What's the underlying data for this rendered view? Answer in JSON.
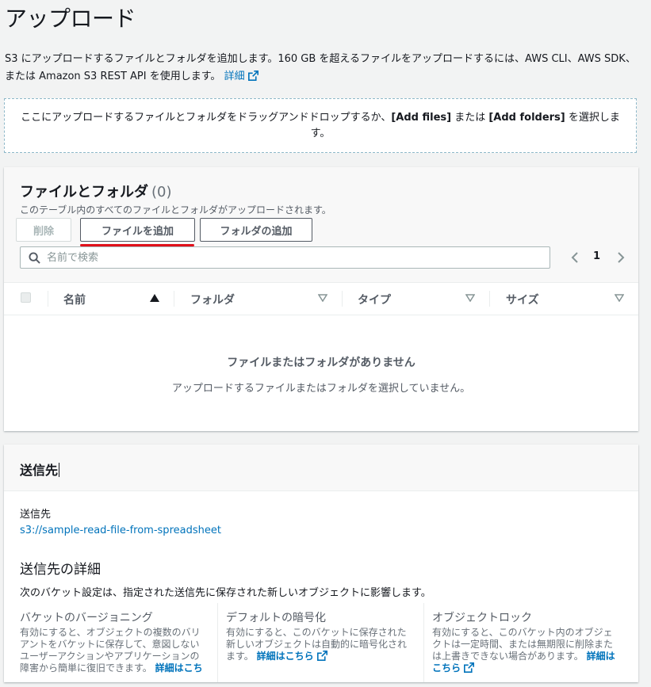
{
  "page": {
    "title": "アップロード",
    "intro_text": "S3 にアップロードするファイルとフォルダを追加します。160 GB を超えるファイルをアップロードするには、AWS CLI、AWS SDK、または Amazon S3 REST API を使用します。",
    "intro_link": "詳細"
  },
  "dropzone": {
    "text_before": "ここにアップロードするファイルとフォルダをドラッグアンドドロップするか、",
    "add_files": "[Add files]",
    "text_middle": " または ",
    "add_folders": "[Add folders]",
    "text_after": " を選択します。"
  },
  "files_panel": {
    "title": "ファイルとフォルダ",
    "count": "(0)",
    "description": "このテーブル内のすべてのファイルとフォルダがアップロードされます。",
    "buttons": {
      "delete": "削除",
      "add_files": "ファイルを追加",
      "add_folder": "フォルダの追加"
    },
    "search": {
      "placeholder": "名前で検索",
      "value": ""
    },
    "pagination": {
      "current_page": "1"
    },
    "columns": [
      {
        "label": "名前",
        "sort": "ascending"
      },
      {
        "label": "フォルダ",
        "sort": "none"
      },
      {
        "label": "タイプ",
        "sort": "none"
      },
      {
        "label": "サイズ",
        "sort": "none"
      }
    ],
    "empty": {
      "title": "ファイルまたはフォルダがありません",
      "description": "アップロードするファイルまたはフォルダを選択していません。"
    }
  },
  "destination": {
    "title": "送信先",
    "label": "送信先",
    "value": "s3://sample-read-file-from-spreadsheet",
    "details_title": "送信先の詳細",
    "details_description": "次のバケット設定は、指定された送信先に保存された新しいオブジェクトに影響します。",
    "settings": [
      {
        "title": "バケットのバージョニング",
        "description": "有効にすると、オブジェクトの複数のバリアントをバケットに保存して、意図しないユーザーアクションやアプリケーションの障害から簡単に復旧できます。",
        "link": "詳細はこち"
      },
      {
        "title": "デフォルトの暗号化",
        "description": "有効にすると、このバケットに保存された新しいオブジェクトは自動的に暗号化されます。",
        "link": "詳細はこちら"
      },
      {
        "title": "オブジェクトロック",
        "description": "有効にすると、このバケット内のオブジェクトは一定時間、または無期限に削除または上書きできない場合があります。",
        "link": "詳細はこちら"
      }
    ]
  },
  "colors": {
    "link": "#0073bb",
    "highlight_underline": "#e0101b",
    "background": "#f2f3f3"
  }
}
